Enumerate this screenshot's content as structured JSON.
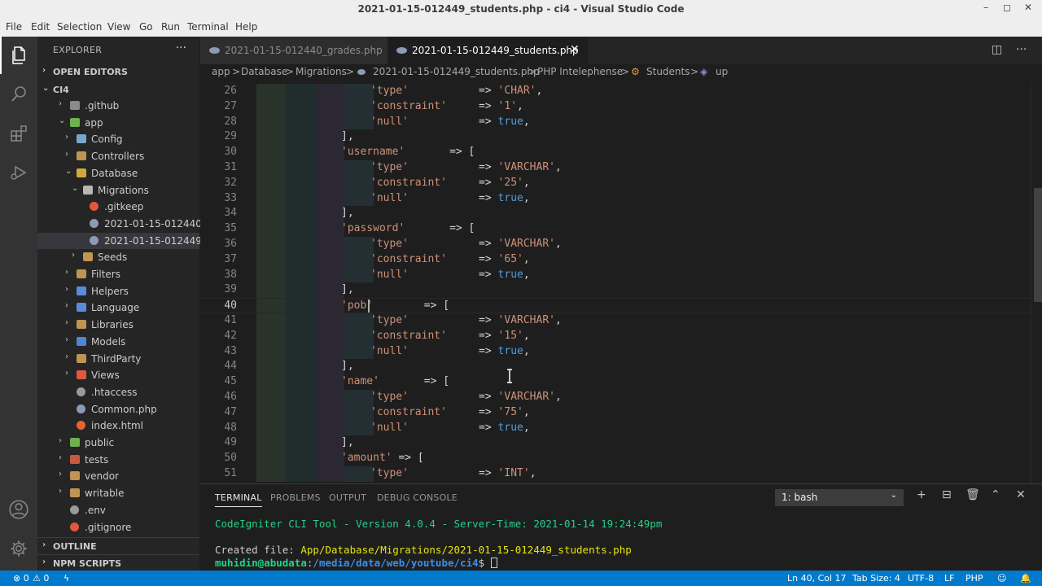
{
  "window": {
    "title": "2021-01-15-012449_students.php - ci4 - Visual Studio Code",
    "controls": {
      "minimize": "–",
      "maximize": "◻",
      "close": "✕"
    }
  },
  "menu": [
    "File",
    "Edit",
    "Selection",
    "View",
    "Go",
    "Run",
    "Terminal",
    "Help"
  ],
  "activity_icons": [
    "files-icon",
    "search-icon",
    "extensions-icon",
    "run-debug-icon",
    "account-icon",
    "settings-gear-icon"
  ],
  "sidebar": {
    "title": "EXPLORER",
    "more": "···",
    "open_editors": "OPEN EDITORS",
    "root": "CI4",
    "tree": [
      {
        "label": ".github",
        "chev": "›",
        "icon": "#8a8a8a"
      },
      {
        "label": "app",
        "chev": "⌄",
        "icon": "#6fb04f"
      },
      {
        "label": "Config",
        "chev": "›",
        "icon": "#79a7c9"
      },
      {
        "label": "Controllers",
        "chev": "›",
        "icon": "#c09553"
      },
      {
        "label": "Database",
        "chev": "⌄",
        "icon": "#d3a83b"
      },
      {
        "label": "Migrations",
        "chev": "⌄",
        "icon": "#b7b7b7"
      },
      {
        "label": ".gitkeep",
        "chev": "",
        "icon": "#e0583d"
      },
      {
        "label": "2021-01-15-012440...",
        "chev": "",
        "icon": "#8a9bb5"
      },
      {
        "label": "2021-01-15-012449...",
        "chev": "",
        "icon": "#8a9bb5"
      },
      {
        "label": "Seeds",
        "chev": "›",
        "icon": "#c09553"
      },
      {
        "label": "Filters",
        "chev": "›",
        "icon": "#c09553"
      },
      {
        "label": "Helpers",
        "chev": "›",
        "icon": "#5b8bd6"
      },
      {
        "label": "Language",
        "chev": "›",
        "icon": "#5b8bd6"
      },
      {
        "label": "Libraries",
        "chev": "›",
        "icon": "#c09553"
      },
      {
        "label": "Models",
        "chev": "›",
        "icon": "#4e86d1"
      },
      {
        "label": "ThirdParty",
        "chev": "›",
        "icon": "#c09553"
      },
      {
        "label": "Views",
        "chev": "›",
        "icon": "#e0583d"
      },
      {
        "label": ".htaccess",
        "chev": "",
        "icon": "#9a9a9a"
      },
      {
        "label": "Common.php",
        "chev": "",
        "icon": "#8a9bb5"
      },
      {
        "label": "index.html",
        "chev": "",
        "icon": "#e56431"
      },
      {
        "label": "public",
        "chev": "›",
        "icon": "#6fb04f"
      },
      {
        "label": "tests",
        "chev": "›",
        "icon": "#c75a3e"
      },
      {
        "label": "vendor",
        "chev": "›",
        "icon": "#c09553"
      },
      {
        "label": "writable",
        "chev": "›",
        "icon": "#c09553"
      },
      {
        "label": ".env",
        "chev": "",
        "icon": "#9a9a9a"
      },
      {
        "label": ".gitignore",
        "chev": "",
        "icon": "#e0583d"
      }
    ],
    "outline": "OUTLINE",
    "npm_scripts": "NPM SCRIPTS"
  },
  "tabs": [
    {
      "label": "2021-01-15-012440_grades.php",
      "active": false
    },
    {
      "label": "2021-01-15-012449_students.php",
      "active": true,
      "close": "✕"
    }
  ],
  "breadcrumb": [
    "app",
    ">",
    "Database",
    ">",
    "Migrations",
    ">",
    "2021-01-15-012449_students.php",
    ">",
    "PHP Intelephense",
    ">",
    "Students",
    ">",
    "up"
  ],
  "editor": {
    "current_line": 40,
    "lines": [
      {
        "n": "26",
        "i": 3,
        "parts": [
          [
            "s",
            "'type'"
          ],
          [
            "p",
            "           => "
          ],
          [
            "s",
            "'CHAR'"
          ],
          [
            "p",
            ","
          ]
        ]
      },
      {
        "n": "27",
        "i": 3,
        "parts": [
          [
            "s",
            "'constraint'"
          ],
          [
            "p",
            "     => "
          ],
          [
            "s",
            "'1'"
          ],
          [
            "p",
            ","
          ]
        ]
      },
      {
        "n": "28",
        "i": 3,
        "parts": [
          [
            "s",
            "'null'"
          ],
          [
            "p",
            "           => "
          ],
          [
            "k",
            "true"
          ],
          [
            "p",
            ","
          ]
        ]
      },
      {
        "n": "29",
        "i": 2,
        "parts": [
          [
            "p",
            "],"
          ]
        ]
      },
      {
        "n": "30",
        "i": 2,
        "parts": [
          [
            "s",
            "'username'"
          ],
          [
            "p",
            "       => ["
          ]
        ]
      },
      {
        "n": "31",
        "i": 3,
        "parts": [
          [
            "s",
            "'type'"
          ],
          [
            "p",
            "           => "
          ],
          [
            "s",
            "'VARCHAR'"
          ],
          [
            "p",
            ","
          ]
        ]
      },
      {
        "n": "32",
        "i": 3,
        "parts": [
          [
            "s",
            "'constraint'"
          ],
          [
            "p",
            "     => "
          ],
          [
            "s",
            "'25'"
          ],
          [
            "p",
            ","
          ]
        ]
      },
      {
        "n": "33",
        "i": 3,
        "parts": [
          [
            "s",
            "'null'"
          ],
          [
            "p",
            "           => "
          ],
          [
            "k",
            "true"
          ],
          [
            "p",
            ","
          ]
        ]
      },
      {
        "n": "34",
        "i": 2,
        "parts": [
          [
            "p",
            "],"
          ]
        ]
      },
      {
        "n": "35",
        "i": 2,
        "parts": [
          [
            "s",
            "'password'"
          ],
          [
            "p",
            "       => ["
          ]
        ]
      },
      {
        "n": "36",
        "i": 3,
        "parts": [
          [
            "s",
            "'type'"
          ],
          [
            "p",
            "           => "
          ],
          [
            "s",
            "'VARCHAR'"
          ],
          [
            "p",
            ","
          ]
        ]
      },
      {
        "n": "37",
        "i": 3,
        "parts": [
          [
            "s",
            "'constraint'"
          ],
          [
            "p",
            "     => "
          ],
          [
            "s",
            "'65'"
          ],
          [
            "p",
            ","
          ]
        ]
      },
      {
        "n": "38",
        "i": 3,
        "parts": [
          [
            "s",
            "'null'"
          ],
          [
            "p",
            "           => "
          ],
          [
            "k",
            "true"
          ],
          [
            "p",
            ","
          ]
        ]
      },
      {
        "n": "39",
        "i": 2,
        "parts": [
          [
            "p",
            "],"
          ]
        ]
      },
      {
        "n": "40",
        "i": 2,
        "parts": [
          [
            "s",
            "'pob'"
          ],
          [
            "p",
            "        => ["
          ]
        ]
      },
      {
        "n": "41",
        "i": 3,
        "parts": [
          [
            "s",
            "'type'"
          ],
          [
            "p",
            "           => "
          ],
          [
            "s",
            "'VARCHAR'"
          ],
          [
            "p",
            ","
          ]
        ]
      },
      {
        "n": "42",
        "i": 3,
        "parts": [
          [
            "s",
            "'constraint'"
          ],
          [
            "p",
            "     => "
          ],
          [
            "s",
            "'15'"
          ],
          [
            "p",
            ","
          ]
        ]
      },
      {
        "n": "43",
        "i": 3,
        "parts": [
          [
            "s",
            "'null'"
          ],
          [
            "p",
            "           => "
          ],
          [
            "k",
            "true"
          ],
          [
            "p",
            ","
          ]
        ]
      },
      {
        "n": "44",
        "i": 2,
        "parts": [
          [
            "p",
            "],"
          ]
        ]
      },
      {
        "n": "45",
        "i": 2,
        "parts": [
          [
            "s",
            "'name'"
          ],
          [
            "p",
            "       => ["
          ]
        ]
      },
      {
        "n": "46",
        "i": 3,
        "parts": [
          [
            "s",
            "'type'"
          ],
          [
            "p",
            "           => "
          ],
          [
            "s",
            "'VARCHAR'"
          ],
          [
            "p",
            ","
          ]
        ]
      },
      {
        "n": "47",
        "i": 3,
        "parts": [
          [
            "s",
            "'constraint'"
          ],
          [
            "p",
            "     => "
          ],
          [
            "s",
            "'75'"
          ],
          [
            "p",
            ","
          ]
        ]
      },
      {
        "n": "48",
        "i": 3,
        "parts": [
          [
            "s",
            "'null'"
          ],
          [
            "p",
            "           => "
          ],
          [
            "k",
            "true"
          ],
          [
            "p",
            ","
          ]
        ]
      },
      {
        "n": "49",
        "i": 2,
        "parts": [
          [
            "p",
            "],"
          ]
        ]
      },
      {
        "n": "50",
        "i": 2,
        "parts": [
          [
            "s",
            "'amount'"
          ],
          [
            "p",
            " => ["
          ]
        ]
      },
      {
        "n": "51",
        "i": 3,
        "parts": [
          [
            "s",
            "'type'"
          ],
          [
            "p",
            "           => "
          ],
          [
            "s",
            "'INT'"
          ],
          [
            "p",
            ","
          ]
        ]
      }
    ]
  },
  "panel": {
    "tabs": [
      "TERMINAL",
      "PROBLEMS",
      "OUTPUT",
      "DEBUG CONSOLE"
    ],
    "shell": "1: bash",
    "tools": [
      "+",
      "⊟",
      "🗑",
      "⌃",
      "✕"
    ],
    "terminal": {
      "line1": "CodeIgniter CLI Tool - Version 4.0.4 - Server-Time: 2021-01-14 19:24:49pm",
      "line2_prefix": "Created file: ",
      "line2_path": "App/Database/Migrations/2021-01-15-012449_students.php",
      "prompt_user": "muhidin@abudata",
      "prompt_sep": ":",
      "prompt_path": "/media/data/web/youtube/ci4",
      "prompt_end": "$ "
    },
    "colors": {
      "green": "#23d18b",
      "yellow": "#e5e510",
      "blue": "#3b8eea",
      "gray": "#cccccc"
    }
  },
  "status": {
    "errors": "⊗ 0",
    "warnings": "⚠ 0",
    "position": "Ln 40, Col 17",
    "tab_size": "Tab Size: 4",
    "encoding": "UTF-8",
    "eol": "LF",
    "language": "PHP"
  }
}
